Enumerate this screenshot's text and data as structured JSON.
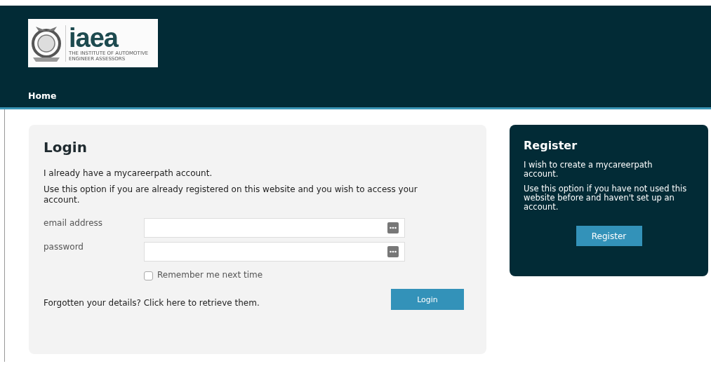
{
  "header": {
    "logo": {
      "wordmark": "iaea",
      "tagline_1": "THE INSTITUTE OF AUTOMOTIVE",
      "tagline_2": "ENGINEER ASSESSORS"
    },
    "nav": [
      {
        "label": "Home"
      }
    ]
  },
  "login": {
    "title": "Login",
    "intro": "I already have a mycareerpath account.",
    "description": "Use this option if you are already registered on this website and you wish to access your account.",
    "fields": [
      {
        "label": "email address"
      },
      {
        "label": "password"
      }
    ],
    "remember": {
      "label": "Remember me next time",
      "checked": false
    },
    "forgot": "Forgotten your details? Click here to retrieve them.",
    "button": "Login"
  },
  "register": {
    "title": "Register",
    "intro": "I wish to create a mycareerpath account.",
    "description": "Use this option if you have not used this website before and haven't set up an account.",
    "button": "Register"
  }
}
